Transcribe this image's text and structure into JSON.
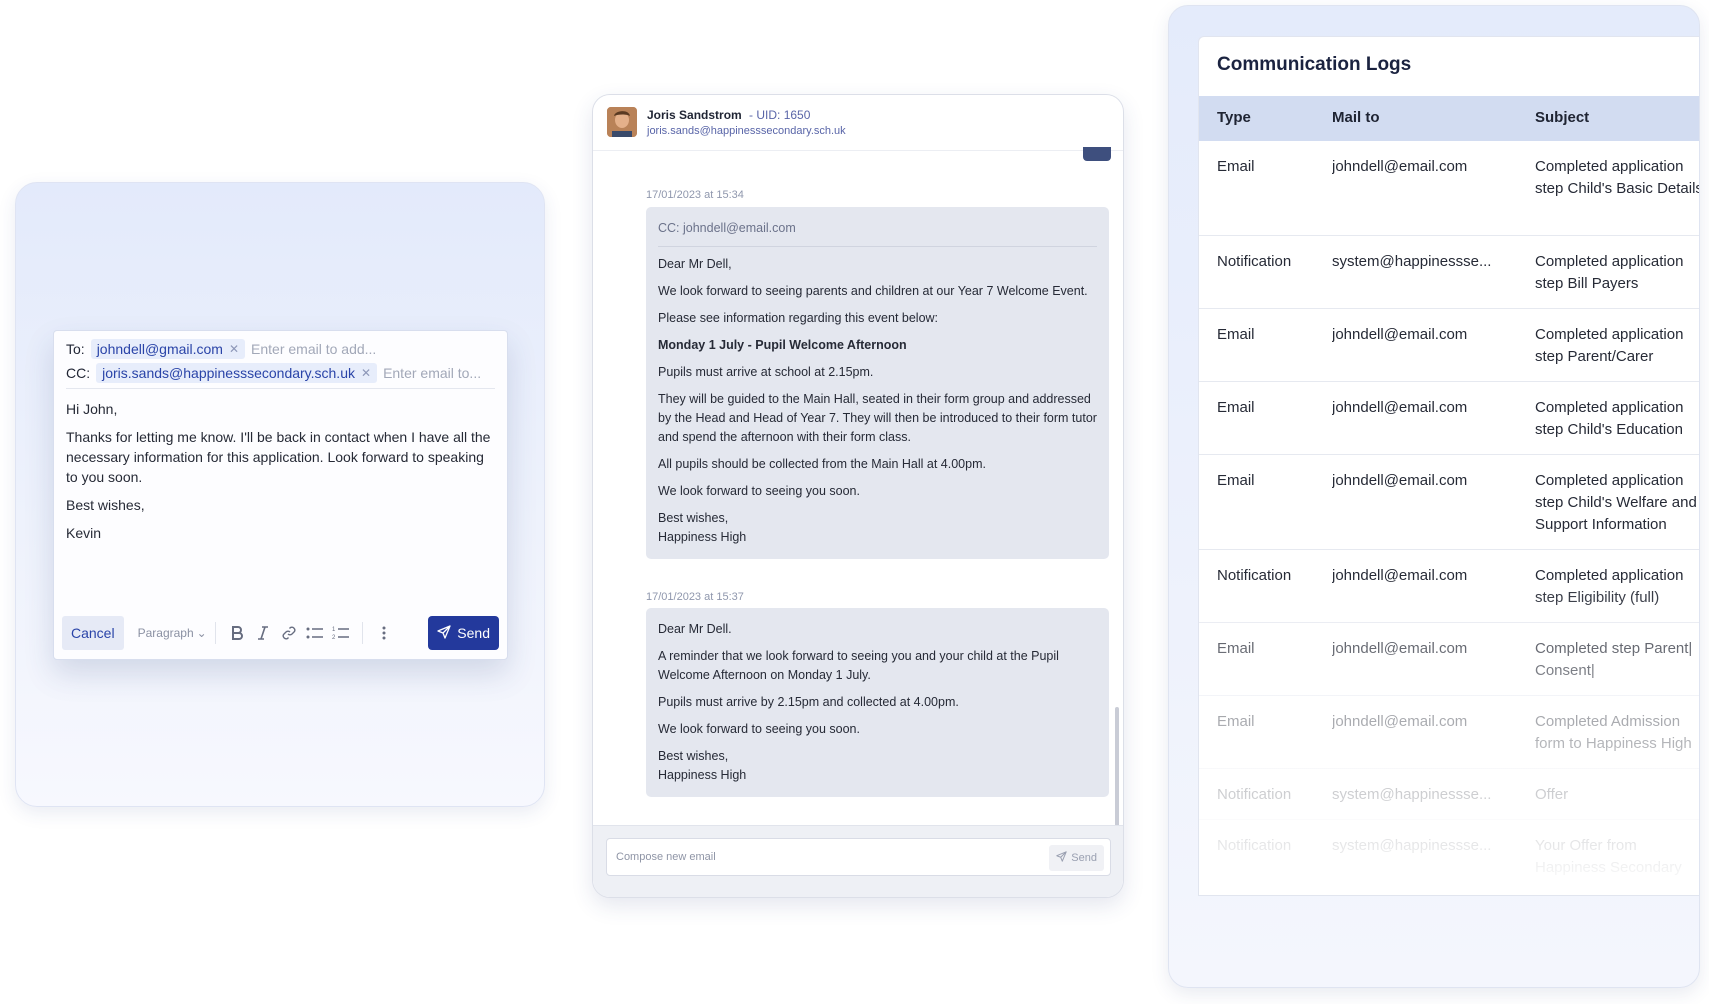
{
  "composer": {
    "to_label": "To:",
    "to_chip": "johndell@gmail.com",
    "to_placeholder": "Enter email to add...",
    "cc_label": "CC:",
    "cc_chip": "joris.sands@happinesssecondary.sch.uk",
    "cc_placeholder": "Enter email to...",
    "body": [
      "Hi John,",
      "Thanks for letting me know. I'll be back in contact when I have all the necessary information for this application. Look forward to speaking to you soon.",
      "Best wishes,",
      "Kevin"
    ],
    "toolbar": {
      "cancel_label": "Cancel",
      "paragraph_label": "Paragraph",
      "send_label": "Send"
    },
    "icons": [
      "bold-icon",
      "italic-icon",
      "link-icon",
      "bullet-list-icon",
      "numbered-list-icon",
      "more-icon",
      "send-icon"
    ],
    "accent_color": "#23399c"
  },
  "chat": {
    "contact_name": "Joris Sandstrom",
    "uid": "- UID: 1650",
    "contact_email": "joris.sands@happinesssecondary.sch.uk",
    "messages": [
      {
        "timestamp": "17/01/2023 at 15:34",
        "cc": "CC: johndell@email.com",
        "paragraphs": [
          "Dear Mr Dell,",
          "We look forward to seeing parents and children at our Year 7 Welcome Event.",
          "Please see information regarding this event below:",
          "Monday 1 July - Pupil Welcome Afternoon",
          "Pupils must arrive at school at 2.15pm.",
          "They will be guided to the Main Hall, seated in their form group and addressed by the Head and Head of Year 7. They will then be introduced to their form tutor and spend the afternoon with their form class.",
          "All pupils should be collected from the Main Hall at 4.00pm.",
          "We look forward to seeing you soon."
        ],
        "signoff": "Best wishes,",
        "signature": "Happiness High"
      },
      {
        "timestamp": "17/01/2023 at 15:37",
        "paragraphs": [
          "Dear Mr Dell.",
          "A reminder that we look forward to seeing you and your child at the Pupil Welcome Afternoon on Monday 1 July.",
          "Pupils must arrive by 2.15pm and collected at 4.00pm.",
          "We look forward to seeing you soon."
        ],
        "signoff": "Best wishes,",
        "signature": "Happiness High"
      }
    ],
    "compose_placeholder": "Compose new email",
    "send_label": "Send"
  },
  "logs": {
    "title": "Communication Logs",
    "columns": [
      "Type",
      "Mail to",
      "Subject"
    ],
    "rows": [
      {
        "type": "Email",
        "mail_to": "johndell@email.com",
        "subject": "Completed application step Child's Basic Details"
      },
      {
        "type": "Notification",
        "mail_to": "system@happinessse...",
        "subject": "Completed application step Bill Payers"
      },
      {
        "type": "Email",
        "mail_to": "johndell@email.com",
        "subject": "Completed application step Parent/Carer"
      },
      {
        "type": "Email",
        "mail_to": "johndell@email.com",
        "subject": "Completed application step Child's Education"
      },
      {
        "type": "Email",
        "mail_to": "johndell@email.com",
        "subject": "Completed application step Child's Welfare and Support Information"
      },
      {
        "type": "Notification",
        "mail_to": "johndell@email.com",
        "subject": "Completed application step Eligibility (full)"
      },
      {
        "type": "Email",
        "mail_to": "johndell@email.com",
        "subject": "Completed step Parent| Consent|"
      },
      {
        "type": "Email",
        "mail_to": "johndell@email.com",
        "subject": "Completed Admission form to Happiness High"
      },
      {
        "type": "Notification",
        "mail_to": "system@happinessse...",
        "subject": "Offer"
      },
      {
        "type": "Notification",
        "mail_to": "system@happinessse...",
        "subject": "Your Offer from Happiness Secondary"
      }
    ]
  }
}
